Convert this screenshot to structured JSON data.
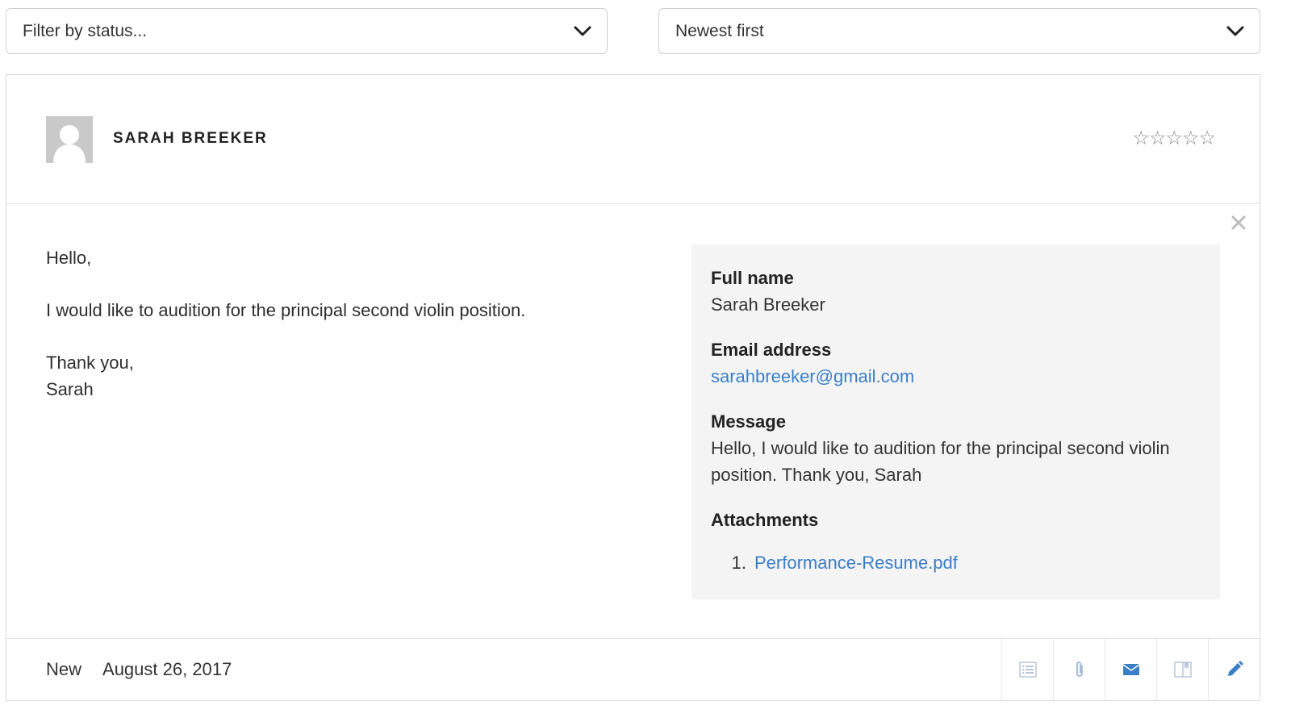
{
  "filters": {
    "status_placeholder": "Filter by status...",
    "sort_value": "Newest first"
  },
  "applicant": {
    "name": "SARAH BREEKER",
    "rating": 0,
    "rating_max": 5
  },
  "message": {
    "greeting": "Hello,",
    "body": "I would like to audition for the principal second violin position.",
    "closing": "Thank you,",
    "signature": "Sarah"
  },
  "details": {
    "full_name_label": "Full name",
    "full_name_value": "Sarah Breeker",
    "email_label": "Email address",
    "email_value": "sarahbreeker@gmail.com",
    "message_label": "Message",
    "message_value": "Hello, I would like to audition for the principal second violin position. Thank you, Sarah",
    "attachments_label": "Attachments",
    "attachments": [
      {
        "num": "1.",
        "name": "Performance-Resume.pdf"
      }
    ]
  },
  "footer": {
    "status": "New",
    "date": "August 26, 2017",
    "actions": [
      "list-icon",
      "paperclip-icon",
      "envelope-icon",
      "book-icon",
      "pencil-icon"
    ]
  },
  "colors": {
    "link": "#3a7ec8",
    "panel_bg": "#f4f4f4",
    "border": "#d8d8d8"
  }
}
